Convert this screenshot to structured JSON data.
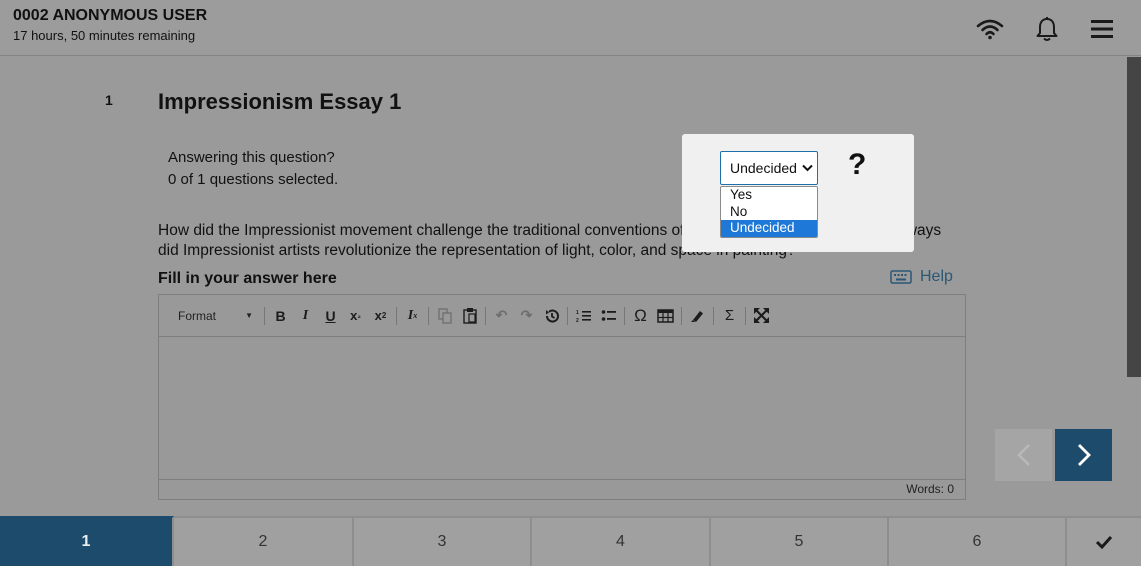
{
  "header": {
    "user_name": "0002 ANONYMOUS USER",
    "time_remaining": "17 hours, 50 minutes remaining",
    "icons": [
      "wifi-icon",
      "bell-icon",
      "menu-icon"
    ]
  },
  "question": {
    "number": "1",
    "title": "Impressionism Essay 1",
    "answering_label": "Answering this question?",
    "selection_status": "0 of 1 questions selected.",
    "prompt_text": "How did the Impressionist movement challenge the traditional conventions of art in the 19th century? In what ways did Impressionist artists revolutionize the representation of light, color, and space in painting?",
    "fill_label": "Fill in your answer here",
    "help_label": "Help"
  },
  "editor": {
    "format_label": "Format",
    "word_count": "Words: 0",
    "tools": [
      "bold",
      "italic",
      "underline",
      "subscript",
      "superscript",
      "remove-format",
      "copy",
      "paste",
      "undo",
      "redo",
      "history",
      "numbered-list",
      "bulleted-list",
      "special-char",
      "table",
      "highlighter",
      "sigma",
      "maximize"
    ]
  },
  "popup": {
    "selected_value": "Undecided",
    "options": [
      "Yes",
      "No",
      "Undecided"
    ],
    "help_glyph": "?"
  },
  "tabs": [
    {
      "label": "1",
      "active": true
    },
    {
      "label": "2",
      "active": false
    },
    {
      "label": "3",
      "active": false
    },
    {
      "label": "4",
      "active": false
    },
    {
      "label": "5",
      "active": false
    },
    {
      "label": "6",
      "active": false
    }
  ],
  "colors": {
    "accent": "#1d4b6c",
    "overlay_bg": "#9a9a9a",
    "selected_option": "#1e78d7",
    "help_link": "#2b5776"
  }
}
